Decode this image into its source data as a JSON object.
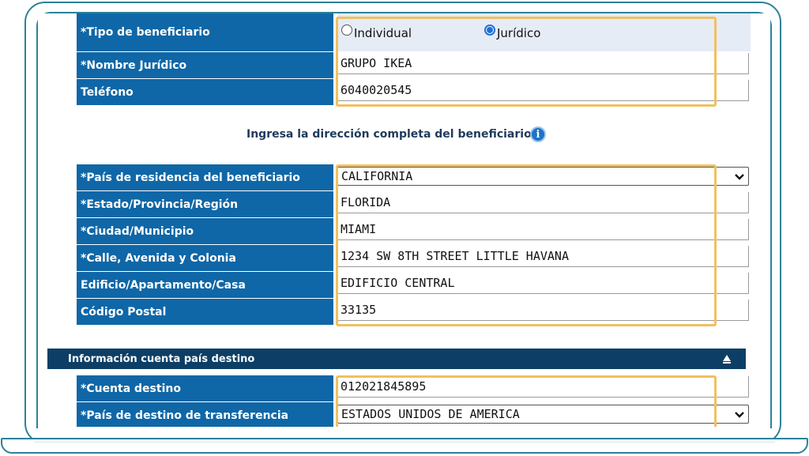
{
  "beneficiary": {
    "type_label": "*Tipo de beneficiario",
    "type_options": [
      "Individual",
      "Jurídico"
    ],
    "type_selected": "Jurídico",
    "name_label": "*Nombre Jurídico",
    "name_value": "GRUPO IKEA",
    "phone_label": "Teléfono",
    "phone_value": "6040020545"
  },
  "address": {
    "instruction": "Ingresa la dirección completa del beneficiario",
    "info_icon": "info-icon",
    "country_label": "*País de residencia del beneficiario",
    "country_value": "CALIFORNIA",
    "state_label": "*Estado/Provincia/Región",
    "state_value": "FLORIDA",
    "city_label": "*Ciudad/Municipio",
    "city_value": "MIAMI",
    "street_label": "*Calle, Avenida y Colonia",
    "street_value": "1234 SW 8TH STREET LITTLE HAVANA",
    "building_label": "Edificio/Apartamento/Casa",
    "building_value": "EDIFICIO CENTRAL",
    "postal_label": "Código Postal",
    "postal_value": "33135"
  },
  "destination": {
    "section_title": "Información cuenta país destino",
    "account_label": "*Cuenta destino",
    "account_value": "012021845895",
    "country_label": "*País de destino de transferencia",
    "country_value": "ESTADOS UNIDOS DE AMERICA"
  },
  "colors": {
    "label_bg": "#0f67a7",
    "section_bg": "#0d3f66",
    "highlight_border": "#f0c060",
    "frame": "#2d8198"
  }
}
